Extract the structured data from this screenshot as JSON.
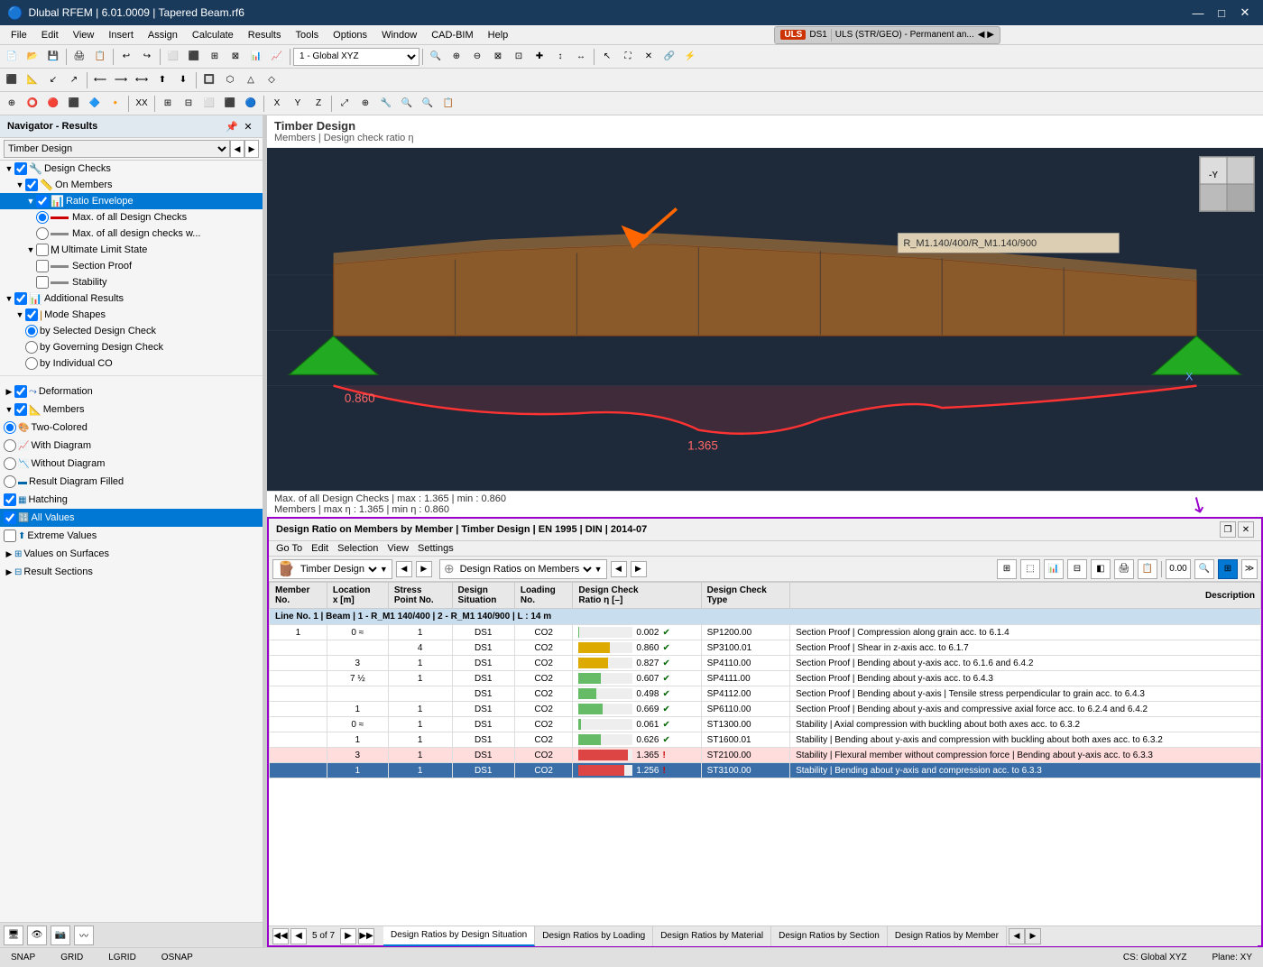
{
  "window": {
    "title": "Dlubal RFEM | 6.01.0009 | Tapered Beam.rf6",
    "min_btn": "—",
    "max_btn": "□",
    "close_btn": "✕"
  },
  "menu": {
    "items": [
      "File",
      "Edit",
      "View",
      "Insert",
      "Assign",
      "Calculate",
      "Results",
      "Tools",
      "Options",
      "Window",
      "CAD-BIM",
      "Help"
    ]
  },
  "navigator": {
    "title": "Navigator - Results",
    "dropdown_label": "Timber Design",
    "design_checks_label": "Design Checks",
    "on_members_label": "On Members",
    "ratio_envelope_label": "Ratio Envelope",
    "max_all_checks_label": "Max. of all Design Checks",
    "max_all_checks_w_label": "Max. of all design checks w...",
    "uls_label": "Ultimate Limit State",
    "section_proof_label": "Section Proof",
    "stability_label": "Stability",
    "additional_results_label": "Additional Results",
    "mode_shapes_label": "Mode Shapes",
    "by_selected_label": "by Selected Design Check",
    "by_governing_label": "by Governing Design Check",
    "by_individual_label": "by Individual CO",
    "deformation_label": "Deformation",
    "members_label": "Members",
    "two_colored_label": "Two-Colored",
    "with_diagram_label": "With Diagram",
    "without_diagram_label": "Without Diagram",
    "result_diagram_filled_label": "Result Diagram Filled",
    "hatching_label": "Hatching",
    "all_values_label": "All Values",
    "extreme_values_label": "Extreme Values",
    "values_on_surfaces_label": "Values on Surfaces",
    "result_sections_label": "Result Sections"
  },
  "viewport": {
    "title": "Timber Design",
    "subtitle": "Members | Design check ratio η",
    "status_line1": "Max. of all Design Checks | max : 1.365 | min : 0.860",
    "status_line2": "Members | max η : 1.365 | min η : 0.860",
    "beam_label": "R_M1.140/400/R_M1.140/900",
    "value_left": "0.860",
    "value_bottom": "1.365"
  },
  "results_window": {
    "title": "Design Ratio on Members by Member | Timber Design | EN 1995 | DIN | 2014-07",
    "menu": [
      "Go To",
      "Edit",
      "Selection",
      "View",
      "Settings"
    ],
    "toolbar1_dropdown": "Timber Design",
    "toolbar2_dropdown": "Design Ratios on Members",
    "columns": [
      "Member No.",
      "Location x [m]",
      "Stress Point No.",
      "Design Situation",
      "Loading No.",
      "Design Check Ratio η [–]",
      "Design Check Type",
      "Description"
    ],
    "row_group": "Line No. 1 | Beam | 1 - R_M1 140/400 | 2 - R_M1 140/900 | L : 14 m",
    "rows": [
      {
        "member": "1",
        "location": "0 ≈",
        "stress_pt": "1",
        "design_sit": "DS1",
        "loading": "CO2",
        "ratio": "0.002",
        "ratio_val": 0.002,
        "check_code": "SP1200.00",
        "check_type": "Section Proof | Compression along grain acc. to 6.1.4",
        "status": "ok",
        "row_class": "row-normal"
      },
      {
        "member": "",
        "location": "",
        "stress_pt": "4",
        "design_sit": "DS1",
        "loading": "CO2",
        "ratio": "0.860",
        "ratio_val": 0.86,
        "check_code": "SP3100.01",
        "check_type": "Section Proof | Shear in z-axis acc. to 6.1.7",
        "status": "ok",
        "row_class": "row-normal"
      },
      {
        "member": "",
        "location": "3",
        "stress_pt": "1",
        "design_sit": "DS1",
        "loading": "CO2",
        "ratio": "0.827",
        "ratio_val": 0.827,
        "check_code": "SP4110.00",
        "check_type": "Section Proof | Bending about y-axis acc. to 6.1.6 and 6.4.2",
        "status": "ok",
        "row_class": "row-normal"
      },
      {
        "member": "",
        "location": "7 ½",
        "stress_pt": "1",
        "design_sit": "DS1",
        "loading": "CO2",
        "ratio": "0.607",
        "ratio_val": 0.607,
        "check_code": "SP4111.00",
        "check_type": "Section Proof | Bending about y-axis acc. to 6.4.3",
        "status": "ok",
        "row_class": "row-normal"
      },
      {
        "member": "",
        "location": "",
        "stress_pt": "",
        "design_sit": "DS1",
        "loading": "CO2",
        "ratio": "0.498",
        "ratio_val": 0.498,
        "check_code": "SP4112.00",
        "check_type": "Section Proof | Bending about y-axis | Tensile stress perpendicular to grain acc. to 6.4.3",
        "status": "ok",
        "row_class": "row-normal"
      },
      {
        "member": "",
        "location": "1",
        "stress_pt": "1",
        "design_sit": "DS1",
        "loading": "CO2",
        "ratio": "0.669",
        "ratio_val": 0.669,
        "check_code": "SP6110.00",
        "check_type": "Section Proof | Bending about y-axis and compressive axial force acc. to 6.2.4 and 6.4.2",
        "status": "ok",
        "row_class": "row-normal"
      },
      {
        "member": "",
        "location": "0 ≈",
        "stress_pt": "1",
        "design_sit": "DS1",
        "loading": "CO2",
        "ratio": "0.061",
        "ratio_val": 0.061,
        "check_code": "ST1300.00",
        "check_type": "Stability | Axial compression with buckling about both axes acc. to 6.3.2",
        "status": "ok",
        "row_class": "row-normal"
      },
      {
        "member": "",
        "location": "1",
        "stress_pt": "1",
        "design_sit": "DS1",
        "loading": "CO2",
        "ratio": "0.626",
        "ratio_val": 0.626,
        "check_code": "ST1600.01",
        "check_type": "Stability | Bending about y-axis and compression with buckling about both axes acc. to 6.3.2",
        "status": "ok",
        "row_class": "row-normal"
      },
      {
        "member": "",
        "location": "3",
        "stress_pt": "1",
        "design_sit": "DS1",
        "loading": "CO2",
        "ratio": "1.365",
        "ratio_val": 1.365,
        "check_code": "ST2100.00",
        "check_type": "Stability | Flexural member without compression force | Bending about y-axis acc. to 6.3.3",
        "status": "fail",
        "row_class": "row-warning"
      },
      {
        "member": "",
        "location": "1",
        "stress_pt": "1",
        "design_sit": "DS1",
        "loading": "CO2",
        "ratio": "1.256",
        "ratio_val": 1.256,
        "check_code": "ST3100.00",
        "check_type": "Stability | Bending about y-axis and compression acc. to 6.3.3",
        "status": "fail",
        "row_class": "row-over selected"
      }
    ],
    "bottom_tabs": [
      "Design Ratios by Design Situation",
      "Design Ratios by Loading",
      "Design Ratios by Material",
      "Design Ratios by Section",
      "Design Ratios by Member"
    ],
    "page_nav": "5 of 7"
  },
  "status_bar": {
    "snap": "SNAP",
    "grid": "GRID",
    "lgrid": "LGRID",
    "osnap": "OSNAP",
    "cs": "CS: Global XYZ",
    "plane": "Plane: XY"
  },
  "icons": {
    "expand": "▶",
    "collapse": "▼",
    "folder": "📁",
    "check": "✓",
    "radio_on": "●",
    "radio_off": "○",
    "checkbox_on": "☑",
    "checkbox_off": "☐",
    "warning": "⚠",
    "error": "✖",
    "ok_check": "✔",
    "arrow_left": "◀",
    "arrow_right": "▶",
    "arrow_first": "◀◀",
    "arrow_last": "▶▶",
    "close": "✕",
    "min": "─",
    "restore": "❐"
  }
}
